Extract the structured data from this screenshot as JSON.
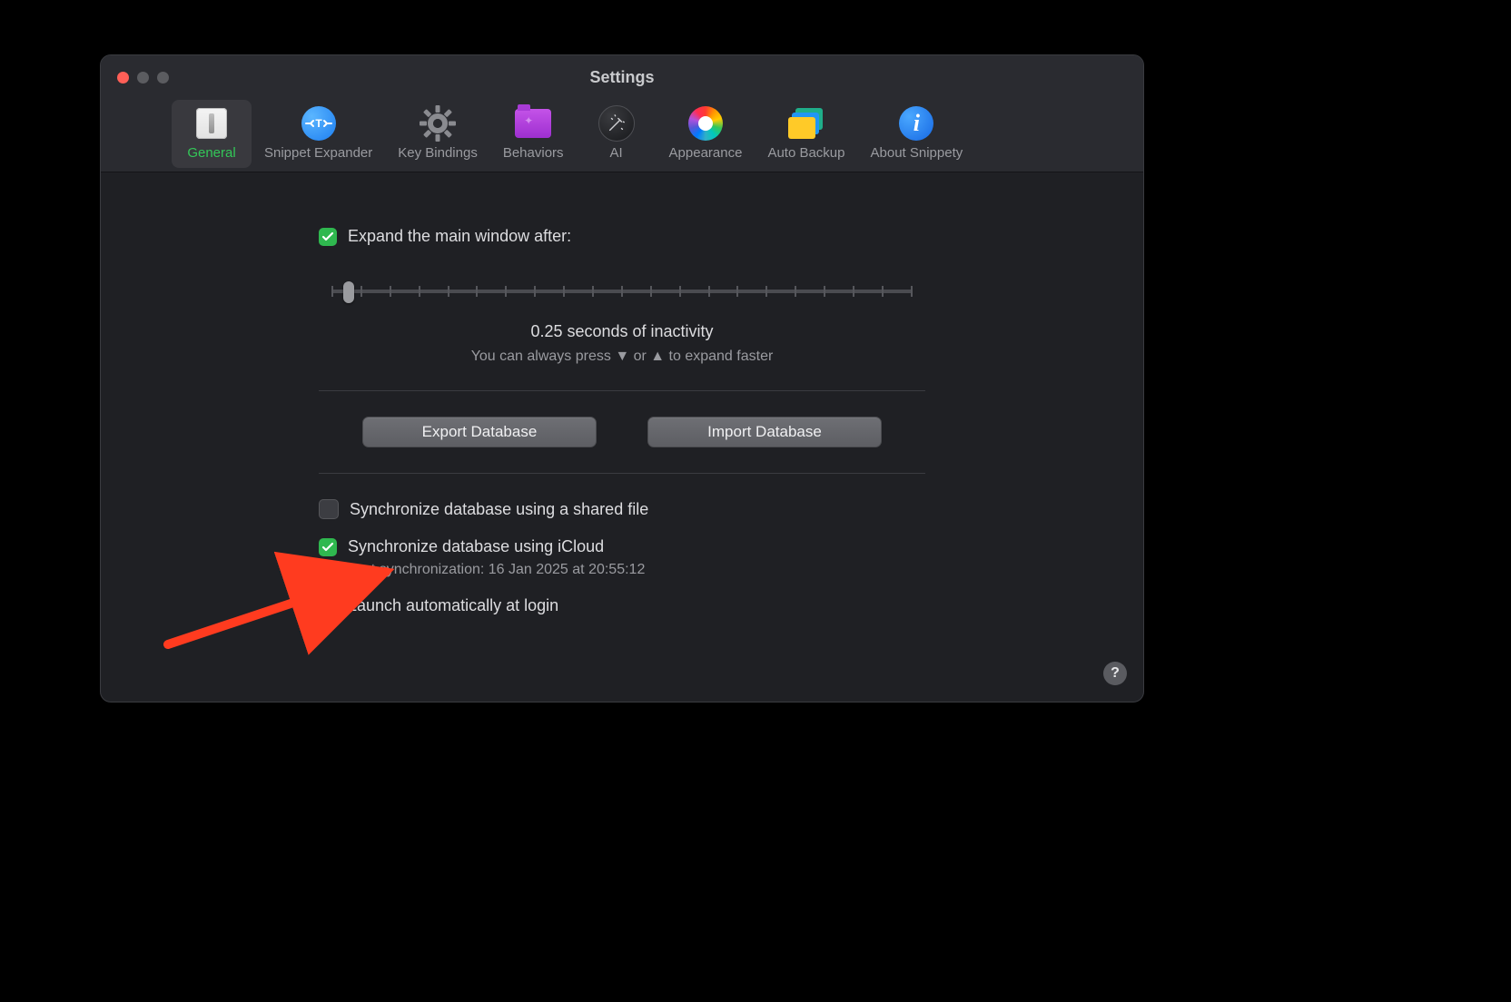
{
  "window": {
    "title": "Settings"
  },
  "toolbar": {
    "items": [
      {
        "id": "general",
        "label": "General",
        "selected": true
      },
      {
        "id": "snippet-expander",
        "label": "Snippet Expander",
        "selected": false
      },
      {
        "id": "key-bindings",
        "label": "Key Bindings",
        "selected": false
      },
      {
        "id": "behaviors",
        "label": "Behaviors",
        "selected": false
      },
      {
        "id": "ai",
        "label": "AI",
        "selected": false
      },
      {
        "id": "appearance",
        "label": "Appearance",
        "selected": false
      },
      {
        "id": "auto-backup",
        "label": "Auto Backup",
        "selected": false
      },
      {
        "id": "about",
        "label": "About Snippety",
        "selected": false
      }
    ]
  },
  "general": {
    "expand_window": {
      "checked": true,
      "label": "Expand the main window after:",
      "value_seconds": 0.25,
      "caption": "0.25 seconds of inactivity",
      "hint": "You can always press ▼ or ▲ to expand faster",
      "slider_min": 0,
      "slider_max": 1,
      "slider_position_pct": 2
    },
    "buttons": {
      "export_label": "Export Database",
      "import_label": "Import Database"
    },
    "sync_shared_file": {
      "checked": false,
      "label": "Synchronize database using a shared file"
    },
    "sync_icloud": {
      "checked": true,
      "label": "Synchronize database using iCloud",
      "subtext": "Last synchronization: 16 Jan 2025 at 20:55:12"
    },
    "launch_at_login": {
      "checked": true,
      "label": "Launch automatically at login"
    }
  },
  "help_button": "?",
  "annotation": {
    "arrow_color": "#ff3b1f",
    "target": "sync_icloud"
  }
}
